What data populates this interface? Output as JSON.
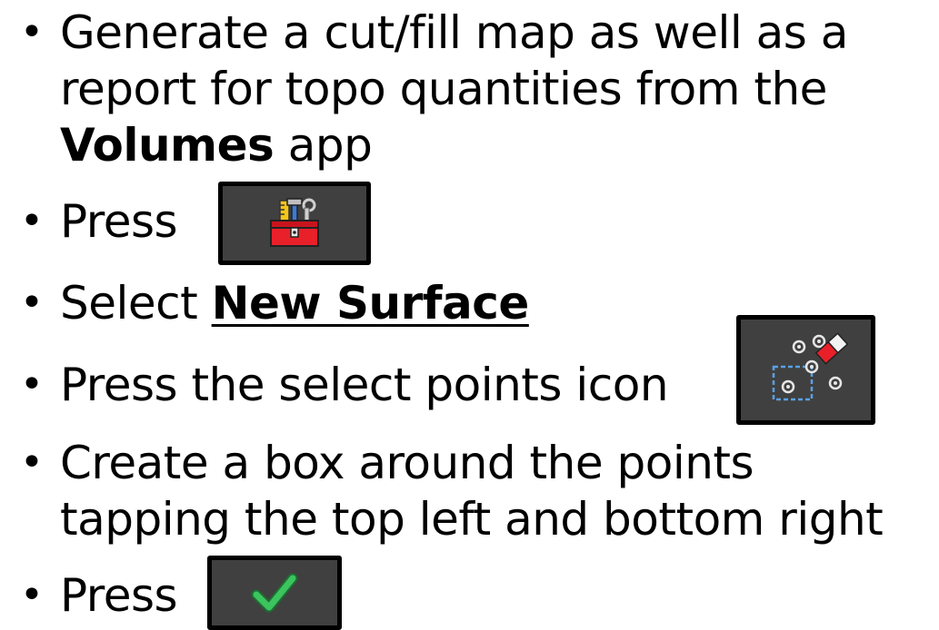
{
  "bullets": [
    {
      "lines": [
        "Generate a cut/fill map as well as a",
        "report for topo quantities from the"
      ],
      "tail_bold": "Volumes",
      "tail_rest": " app"
    },
    {
      "text": "Press",
      "icon": "toolbox-icon"
    },
    {
      "prefix": "Select ",
      "bold_underline": "New Surface"
    },
    {
      "text": "Press the select points icon",
      "icon": "select-points-icon"
    },
    {
      "lines": [
        "Create a box around the points",
        "tapping the top left and bottom right"
      ]
    },
    {
      "text": "Press",
      "icon": "checkmark-icon"
    }
  ],
  "bullet_char": "•",
  "colors": {
    "button_bg": "#404040",
    "button_border": "#000000",
    "toolbox_red": "#e8202a",
    "check_green": "#2fa84f"
  }
}
